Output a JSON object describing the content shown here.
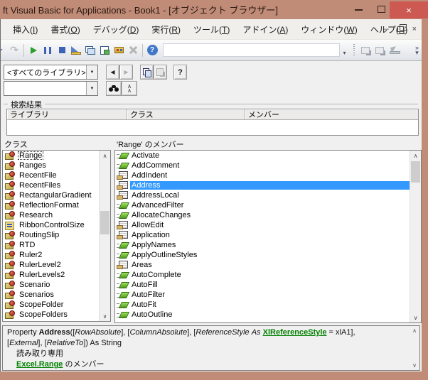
{
  "window": {
    "title": "ft Visual Basic for Applications - Book1 - [オブジェクト ブラウザー]",
    "titlebar_color": "#c08b77",
    "close_button_color": "#cd5a52"
  },
  "menubar": {
    "items": [
      "挿入(I)",
      "書式(O)",
      "デバッグ(D)",
      "実行(R)",
      "ツール(T)",
      "アドイン(A)",
      "ウィンドウ(W)",
      "ヘルプ(H)"
    ]
  },
  "toolbar": {
    "buttons": [
      {
        "icon": "undo-icon",
        "enabled": true
      },
      {
        "icon": "redo-icon",
        "enabled": false
      },
      {
        "sep": true
      },
      {
        "icon": "run-icon",
        "enabled": true
      },
      {
        "icon": "break-icon",
        "enabled": true
      },
      {
        "icon": "reset-icon",
        "enabled": true
      },
      {
        "icon": "design-mode-icon",
        "enabled": true
      },
      {
        "icon": "project-explorer-icon",
        "enabled": true
      },
      {
        "icon": "properties-window-icon",
        "enabled": true
      },
      {
        "icon": "toolbox-icon",
        "enabled": true
      },
      {
        "icon": "object-browser-icon",
        "enabled": false
      },
      {
        "sep": true
      },
      {
        "icon": "help-icon",
        "enabled": true
      }
    ],
    "textbox_value": "",
    "right_buttons": [
      {
        "icon": "view-object-icon",
        "enabled": false
      },
      {
        "icon": "view-code-icon",
        "enabled": false
      },
      {
        "icon": "procedure-view-icon",
        "enabled": false
      }
    ]
  },
  "browser": {
    "library_value": "<すべてのライブラリ>",
    "search_value": "",
    "search_results": {
      "label": "検索結果",
      "columns": [
        "ライブラリ",
        "クラス",
        "メンバー"
      ]
    },
    "classes": {
      "header": "クラス",
      "items": [
        {
          "name": "Range",
          "icon": "class",
          "selected": true
        },
        {
          "name": "Ranges",
          "icon": "class"
        },
        {
          "name": "RecentFile",
          "icon": "class"
        },
        {
          "name": "RecentFiles",
          "icon": "class"
        },
        {
          "name": "RectangularGradient",
          "icon": "class"
        },
        {
          "name": "ReflectionFormat",
          "icon": "class"
        },
        {
          "name": "Research",
          "icon": "class"
        },
        {
          "name": "RibbonControlSize",
          "icon": "enum"
        },
        {
          "name": "RoutingSlip",
          "icon": "class"
        },
        {
          "name": "RTD",
          "icon": "class"
        },
        {
          "name": "Ruler2",
          "icon": "class"
        },
        {
          "name": "RulerLevel2",
          "icon": "class"
        },
        {
          "name": "RulerLevels2",
          "icon": "class"
        },
        {
          "name": "Scenario",
          "icon": "class"
        },
        {
          "name": "Scenarios",
          "icon": "class"
        },
        {
          "name": "ScopeFolder",
          "icon": "class"
        },
        {
          "name": "ScopeFolders",
          "icon": "class"
        }
      ]
    },
    "members": {
      "header": "'Range' のメンバー",
      "items": [
        {
          "name": "Activate",
          "icon": "method"
        },
        {
          "name": "AddComment",
          "icon": "method"
        },
        {
          "name": "AddIndent",
          "icon": "property"
        },
        {
          "name": "Address",
          "icon": "property",
          "selected": true
        },
        {
          "name": "AddressLocal",
          "icon": "property"
        },
        {
          "name": "AdvancedFilter",
          "icon": "method"
        },
        {
          "name": "AllocateChanges",
          "icon": "method"
        },
        {
          "name": "AllowEdit",
          "icon": "property"
        },
        {
          "name": "Application",
          "icon": "property"
        },
        {
          "name": "ApplyNames",
          "icon": "method"
        },
        {
          "name": "ApplyOutlineStyles",
          "icon": "method"
        },
        {
          "name": "Areas",
          "icon": "property"
        },
        {
          "name": "AutoComplete",
          "icon": "method"
        },
        {
          "name": "AutoFill",
          "icon": "method"
        },
        {
          "name": "AutoFilter",
          "icon": "method"
        },
        {
          "name": "AutoFit",
          "icon": "method"
        },
        {
          "name": "AutoOutline",
          "icon": "method"
        }
      ]
    },
    "details": {
      "lines": [
        {
          "indent": false,
          "segments": [
            [
              "Property ",
              "plain"
            ],
            [
              "Address",
              "bold"
            ],
            [
              "([",
              "plain"
            ],
            [
              "RowAbsolute",
              "italic"
            ],
            [
              "], [",
              "plain"
            ],
            [
              "ColumnAbsolute",
              "italic"
            ],
            [
              "], [",
              "plain"
            ],
            [
              "ReferenceStyle",
              "italic"
            ],
            [
              " ",
              "plain"
            ],
            [
              "As",
              "italic"
            ],
            [
              " ",
              "plain"
            ],
            [
              "XlReferenceStyle",
              "link"
            ],
            [
              " = xlA1],",
              "plain"
            ]
          ]
        },
        {
          "indent": false,
          "segments": [
            [
              "[",
              "plain"
            ],
            [
              "External",
              "italic"
            ],
            [
              "], [",
              "plain"
            ],
            [
              "RelativeTo",
              "italic"
            ],
            [
              "]) As String",
              "plain"
            ]
          ]
        },
        {
          "indent": true,
          "segments": [
            [
              "読み取り専用",
              "plain"
            ]
          ]
        },
        {
          "indent": true,
          "segments": [
            [
              "Excel.Range",
              "link"
            ],
            [
              " のメンバー",
              "plain"
            ]
          ]
        }
      ]
    }
  },
  "colors": {
    "selection": "#3399ff",
    "link_green": "#008000"
  }
}
